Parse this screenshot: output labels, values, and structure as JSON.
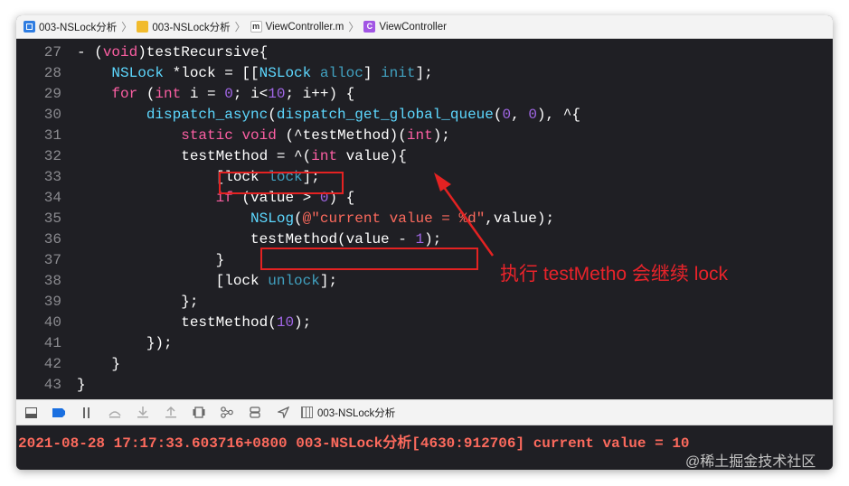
{
  "breadcrumbs": [
    {
      "label": "003-NSLock分析",
      "icon": "xcode-project-icon"
    },
    {
      "label": "003-NSLock分析",
      "icon": "folder-icon"
    },
    {
      "label": "ViewController.m",
      "icon": "objc-file-icon",
      "badge": "m"
    },
    {
      "label": "ViewController",
      "icon": "class-icon",
      "badge": "C"
    }
  ],
  "code_lines": [
    {
      "n": "27",
      "text": "- (void)testRecursive{"
    },
    {
      "n": "28",
      "text": "    NSLock *lock = [[NSLock alloc] init];"
    },
    {
      "n": "29",
      "text": "    for (int i = 0; i<10; i++) {"
    },
    {
      "n": "30",
      "text": "        dispatch_async(dispatch_get_global_queue(0, 0), ^{"
    },
    {
      "n": "31",
      "text": "            static void (^testMethod)(int);"
    },
    {
      "n": "32",
      "text": "            testMethod = ^(int value){"
    },
    {
      "n": "33",
      "text": "                [lock lock];"
    },
    {
      "n": "34",
      "text": "                if (value > 0) {"
    },
    {
      "n": "35",
      "text": "                    NSLog(@\"current value = %d\",value);"
    },
    {
      "n": "36",
      "text": "                    testMethod(value - 1);"
    },
    {
      "n": "37",
      "text": "                }"
    },
    {
      "n": "38",
      "text": "                [lock unlock];"
    },
    {
      "n": "39",
      "text": "            };"
    },
    {
      "n": "40",
      "text": "            testMethod(10);"
    },
    {
      "n": "41",
      "text": "        });"
    },
    {
      "n": "42",
      "text": "    }"
    },
    {
      "n": "43",
      "text": "}"
    }
  ],
  "annotation": "执行 testMetho 会继续 lock",
  "debug_bar": {
    "buttons": [
      "hide-console-icon",
      "breakpoints-icon",
      "pause-icon",
      "step-over-icon",
      "step-into-icon",
      "step-out-icon",
      "view-debugger-icon",
      "memory-graph-icon",
      "environment-icon",
      "location-icon"
    ],
    "target": "003-NSLock分析"
  },
  "console_output": "2021-08-28 17:17:33.603716+0800 003-NSLock分析[4630:912706] current value = 10",
  "watermark": "@稀土掘金技术社区",
  "colors": {
    "keyword": "#fc5fa3",
    "type": "#5dd8ff",
    "number": "#d0bf69",
    "string": "#fc6a5d",
    "annotation": "#e8232a"
  }
}
